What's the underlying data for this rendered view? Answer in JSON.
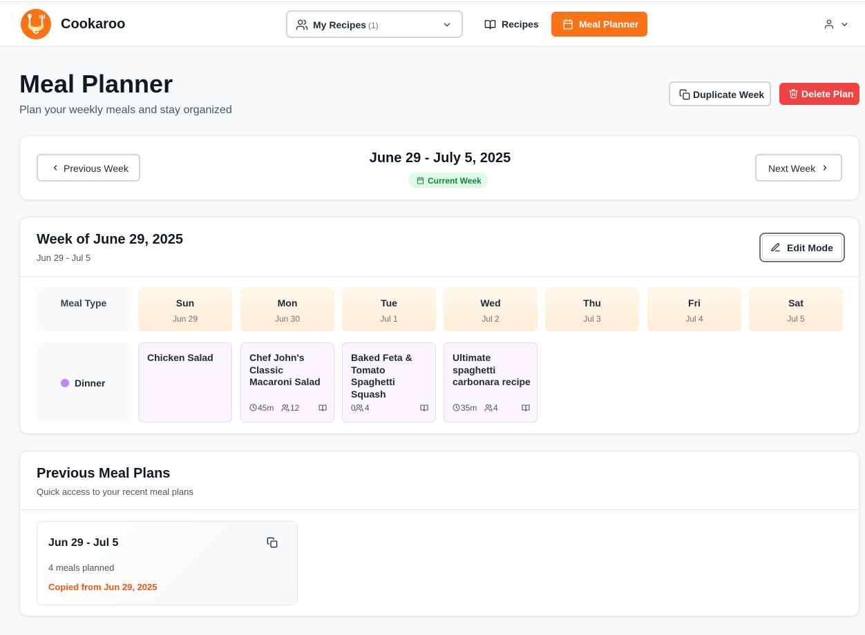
{
  "app": {
    "brand": "Cookaroo",
    "accent": "#f97316",
    "danger": "#ef4444"
  },
  "header": {
    "recipe_select": {
      "label": "My Recipes",
      "count": "(1)",
      "icon": "users-icon"
    },
    "nav": [
      {
        "label": "Recipes",
        "icon": "book-open-icon",
        "active": false
      },
      {
        "label": "Meal Planner",
        "icon": "calendar-icon",
        "active": true
      }
    ],
    "user_icon": "user-icon"
  },
  "page": {
    "title": "Meal Planner",
    "subtitle": "Plan your weekly meals and stay organized",
    "duplicate_label": "Duplicate Week",
    "delete_label": "Delete Plan"
  },
  "week_nav": {
    "prev_label": "Previous Week",
    "next_label": "Next Week",
    "range": "June 29 - July 5, 2025",
    "badge": "Current Week"
  },
  "plan": {
    "title": "Week of June 29, 2025",
    "subtitle": "Jun 29 - Jul 5",
    "edit_label": "Edit Mode",
    "meal_type_header": "Meal Type",
    "days": [
      {
        "day": "Sun",
        "date": "Jun 29"
      },
      {
        "day": "Mon",
        "date": "Jun 30"
      },
      {
        "day": "Tue",
        "date": "Jul 1"
      },
      {
        "day": "Wed",
        "date": "Jul 2"
      },
      {
        "day": "Thu",
        "date": "Jul 3"
      },
      {
        "day": "Fri",
        "date": "Jul 4"
      },
      {
        "day": "Sat",
        "date": "Jul 5"
      }
    ],
    "rows": [
      {
        "meal_type": "Dinner",
        "dot_color": "#c084fc",
        "meals": [
          {
            "name": "Chicken Salad",
            "time": "",
            "servings": ""
          },
          {
            "name": "Chef John's Classic Macaroni Salad",
            "time": "45m",
            "servings": "12"
          },
          {
            "name": "Baked Feta & Tomato Spaghetti Squash",
            "time": "0",
            "servings": "4"
          },
          {
            "name": "Ultimate spaghetti carbonara recipe",
            "time": "35m",
            "servings": "4"
          }
        ]
      }
    ]
  },
  "previous": {
    "title": "Previous Meal Plans",
    "subtitle": "Quick access to your recent meal plans",
    "items": [
      {
        "range": "Jun 29 - Jul 5",
        "meals": "4 meals planned",
        "copied_from": "Copied from Jun 29, 2025"
      }
    ]
  }
}
